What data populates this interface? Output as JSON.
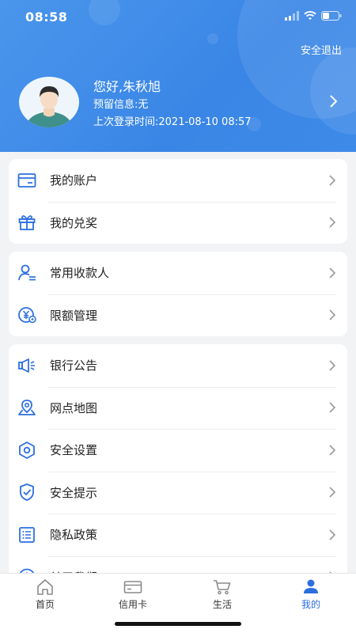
{
  "status_bar": {
    "time": "08:58"
  },
  "header": {
    "logout_label": "安全退出",
    "greeting": "您好,朱秋旭",
    "reserve_info": "预留信息:无",
    "last_login": "上次登录时间:2021-08-10 08:57"
  },
  "groups": [
    {
      "items": [
        {
          "label": "我的账户",
          "icon": "account-card-icon"
        },
        {
          "label": "我的兑奖",
          "icon": "gift-icon"
        }
      ]
    },
    {
      "items": [
        {
          "label": "常用收款人",
          "icon": "payee-icon"
        },
        {
          "label": "限额管理",
          "icon": "limit-yuan-icon"
        }
      ]
    },
    {
      "items": [
        {
          "label": "银行公告",
          "icon": "megaphone-icon"
        },
        {
          "label": "网点地图",
          "icon": "map-pin-icon"
        },
        {
          "label": "安全设置",
          "icon": "hexagon-settings-icon"
        },
        {
          "label": "安全提示",
          "icon": "shield-check-icon"
        },
        {
          "label": "隐私政策",
          "icon": "list-document-icon"
        },
        {
          "label": "关于我们",
          "icon": "info-icon"
        }
      ]
    }
  ],
  "tabbar": [
    {
      "label": "首页",
      "icon": "home-icon"
    },
    {
      "label": "信用卡",
      "icon": "credit-card-icon"
    },
    {
      "label": "生活",
      "icon": "cart-icon"
    },
    {
      "label": "我的",
      "icon": "person-icon",
      "active": true
    }
  ],
  "colors": {
    "accent": "#2c6fe0",
    "header": "#4a96ec"
  }
}
